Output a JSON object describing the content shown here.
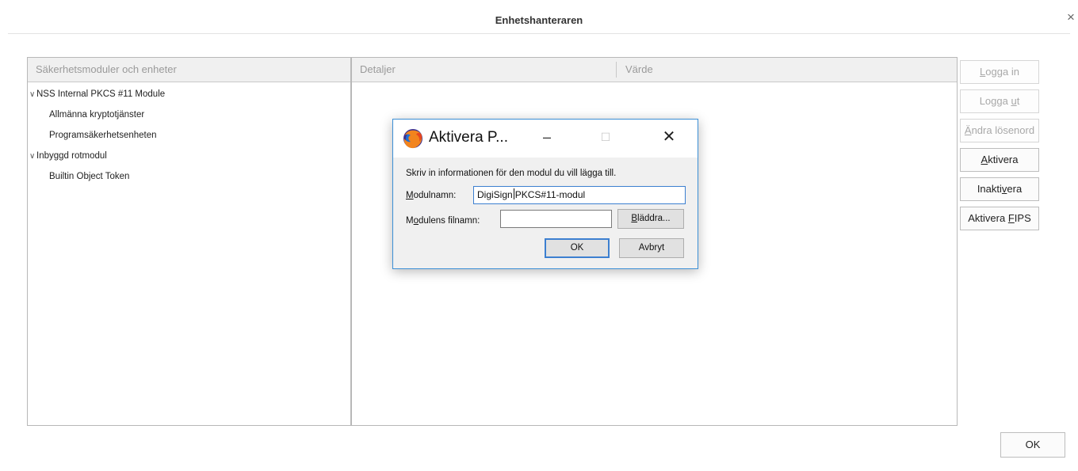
{
  "window": {
    "title": "Enhetshanteraren",
    "close_glyph": "×"
  },
  "left_panel": {
    "header": "Säkerhetsmoduler och enheter",
    "tree": [
      {
        "label": "NSS Internal PKCS #11 Module",
        "level": 0,
        "expanded": true
      },
      {
        "label": "Allmänna kryptotjänster",
        "level": 1
      },
      {
        "label": "Programsäkerhetsenheten",
        "level": 1
      },
      {
        "label": "Inbyggd rotmodul",
        "level": 0,
        "expanded": true
      },
      {
        "label": "Builtin Object Token",
        "level": 1
      }
    ]
  },
  "right_panel": {
    "header_details": "Detaljer",
    "header_value": "Värde"
  },
  "side_buttons": {
    "login": "Logga in",
    "logout": "Logga ut",
    "change_password": "Ändra lösenord",
    "activate": "Aktivera",
    "deactivate": "Inaktivera",
    "enable_fips": "Aktivera FIPS"
  },
  "main_ok_label": "OK",
  "dialog": {
    "title": "Aktivera P...",
    "icon": "firefox-icon",
    "minimize_glyph": "–",
    "maximize_glyph": "☐",
    "close_glyph": "✕",
    "prompt": "Skriv in informationen för den modul du vill lägga till.",
    "module_name_label": "Modulnamn:",
    "module_name_value_before_caret": "DigiSign",
    "module_name_value_after_caret": "PKCS#11-modul",
    "module_file_label": "Modulens filnamn:",
    "module_file_value": "",
    "browse_label": "Bläddra...",
    "ok_label": "OK",
    "cancel_label": "Avbryt"
  }
}
